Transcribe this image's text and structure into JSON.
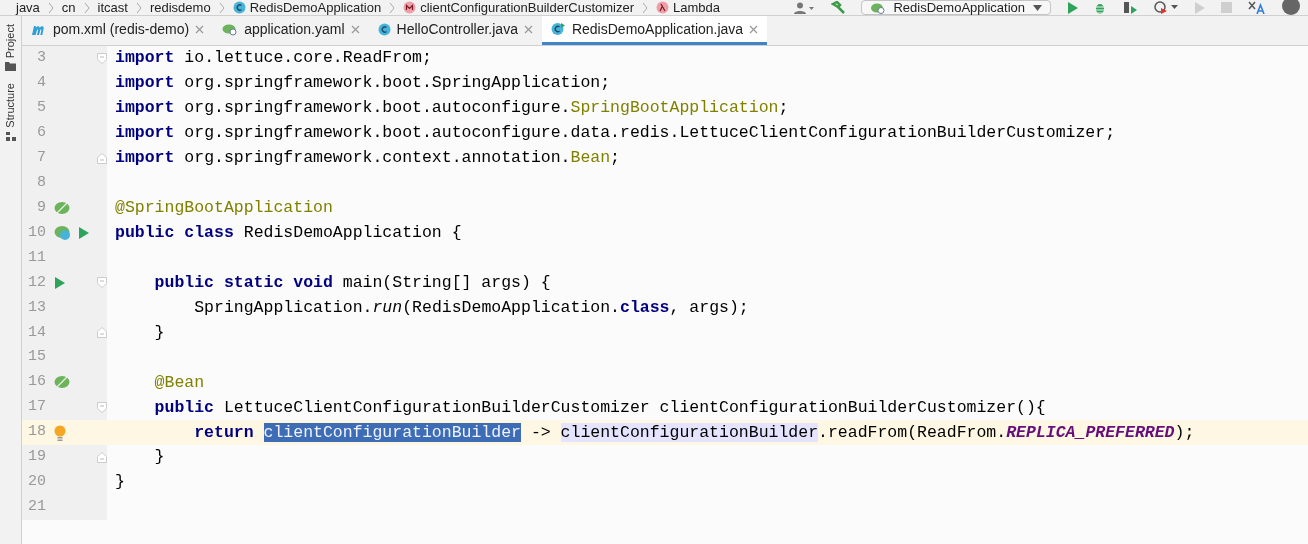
{
  "breadcrumbs": [
    {
      "label": "java",
      "kind": "package"
    },
    {
      "label": "cn",
      "kind": "package"
    },
    {
      "label": "itcast",
      "kind": "package"
    },
    {
      "label": "redisdemo",
      "kind": "package"
    },
    {
      "label": "RedisDemoApplication",
      "kind": "class"
    },
    {
      "label": "clientConfigurationBuilderCustomizer",
      "kind": "method"
    },
    {
      "label": "Lambda",
      "kind": "lambda"
    }
  ],
  "toolbar": {
    "run_config": "RedisDemoApplication"
  },
  "side_tabs": [
    "Project",
    "Structure"
  ],
  "tabs": [
    {
      "label": "pom.xml (redis-demo)",
      "kind": "maven",
      "selected": false
    },
    {
      "label": "application.yaml",
      "kind": "yaml",
      "selected": false
    },
    {
      "label": "HelloController.java",
      "kind": "class",
      "selected": false
    },
    {
      "label": "RedisDemoApplication.java",
      "kind": "app",
      "selected": true
    }
  ],
  "lines": [
    {
      "number": "3",
      "fold": {
        "kind": "start"
      },
      "current": false,
      "tokens": [
        {
          "kind": "keyword",
          "text": "import"
        },
        {
          "kind": "plain",
          "text": " io.lettuce.core.ReadFrom;"
        }
      ]
    },
    {
      "number": "4",
      "current": false,
      "tokens": [
        {
          "kind": "keyword",
          "text": "import"
        },
        {
          "kind": "plain",
          "text": " org.springframework.boot.SpringApplication;"
        }
      ]
    },
    {
      "number": "5",
      "current": false,
      "tokens": [
        {
          "kind": "keyword",
          "text": "import"
        },
        {
          "kind": "plain",
          "text": " org.springframework.boot.autoconfigure."
        },
        {
          "kind": "annotation",
          "text": "SpringBootApplication"
        },
        {
          "kind": "plain",
          "text": ";"
        }
      ]
    },
    {
      "number": "6",
      "current": false,
      "tokens": [
        {
          "kind": "keyword",
          "text": "import"
        },
        {
          "kind": "plain",
          "text": " org.springframework.boot.autoconfigure.data.redis.LettuceClientConfigurationBuilderCustomizer;"
        }
      ]
    },
    {
      "number": "7",
      "fold": {
        "kind": "end"
      },
      "current": false,
      "tokens": [
        {
          "kind": "keyword",
          "text": "import"
        },
        {
          "kind": "plain",
          "text": " org.springframework.context.annotation."
        },
        {
          "kind": "annotation",
          "text": "Bean"
        },
        {
          "kind": "plain",
          "text": ";"
        }
      ]
    },
    {
      "number": "8",
      "current": false
    },
    {
      "number": "9",
      "current": false,
      "gutter": [
        {
          "kind": "bean"
        }
      ],
      "tokens": [
        {
          "kind": "annotation",
          "text": "@SpringBootApplication"
        }
      ]
    },
    {
      "number": "10",
      "current": false,
      "gutter": [
        {
          "kind": "spring"
        },
        {
          "kind": "run"
        }
      ],
      "tokens": [
        {
          "kind": "keyword",
          "text": "public class"
        },
        {
          "kind": "plain",
          "text": " RedisDemoApplication {"
        }
      ]
    },
    {
      "number": "11",
      "current": false
    },
    {
      "number": "12",
      "fold": {
        "kind": "start"
      },
      "current": false,
      "gutter": [
        {
          "kind": "run"
        }
      ],
      "tokens": [
        {
          "kind": "keyword",
          "text": "    public static void"
        },
        {
          "kind": "plain",
          "text": " main(String[] args) {"
        }
      ]
    },
    {
      "number": "13",
      "current": false,
      "tokens": [
        {
          "kind": "plain",
          "text": "        SpringApplication."
        },
        {
          "kind": "italic",
          "text": "run"
        },
        {
          "kind": "plain",
          "text": "(RedisDemoApplication."
        },
        {
          "kind": "keyword",
          "text": "class"
        },
        {
          "kind": "plain",
          "text": ", args);"
        }
      ]
    },
    {
      "number": "14",
      "fold": {
        "kind": "end"
      },
      "current": false,
      "tokens": [
        {
          "kind": "plain",
          "text": "    }"
        }
      ]
    },
    {
      "number": "15",
      "current": false
    },
    {
      "number": "16",
      "current": false,
      "gutter": [
        {
          "kind": "bean"
        }
      ],
      "tokens": [
        {
          "kind": "annotation",
          "text": "    @Bean"
        }
      ]
    },
    {
      "number": "17",
      "fold": {
        "kind": "start"
      },
      "current": false,
      "tokens": [
        {
          "kind": "keyword",
          "text": "    public"
        },
        {
          "kind": "plain",
          "text": " LettuceClientConfigurationBuilderCustomizer clientConfigurationBuilderCustomizer(){"
        }
      ]
    },
    {
      "number": "18",
      "current": true,
      "gutter": [
        {
          "kind": "bulb"
        }
      ],
      "tokens": [
        {
          "kind": "keyword",
          "text": "        return "
        },
        {
          "kind": "selection",
          "text": "clientConfigurationBuilder"
        },
        {
          "kind": "plain",
          "text": " -> "
        },
        {
          "kind": "usage",
          "text": "clientConfigurationBuilder"
        },
        {
          "kind": "plain",
          "text": ".readFrom(ReadFrom."
        },
        {
          "kind": "constant",
          "text": "REPLICA_PREFERRED"
        },
        {
          "kind": "plain",
          "text": ");"
        }
      ]
    },
    {
      "number": "19",
      "fold": {
        "kind": "end"
      },
      "current": false,
      "tokens": [
        {
          "kind": "plain",
          "text": "    }"
        }
      ]
    },
    {
      "number": "20",
      "current": false,
      "tokens": [
        {
          "kind": "plain",
          "text": "}"
        }
      ]
    },
    {
      "number": "21",
      "current": false
    }
  ]
}
